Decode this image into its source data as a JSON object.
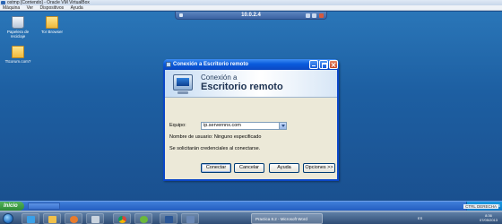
{
  "host_window": {
    "title": "ostmp [Corriendo] - Oracle VM VirtualBox",
    "menu": [
      "Máquina",
      "Ver",
      "Dispositivos",
      "Ayuda"
    ]
  },
  "guest": {
    "rdp_bar_title": "10.0.2.4",
    "desktop_icons": [
      {
        "label": "Papelera de reciclaje",
        "icon": "recycle-bin-icon"
      },
      {
        "label": "Tor Browser",
        "icon": "folder-icon"
      },
      {
        "label": "Ttcorum.com?",
        "icon": "folder-icon"
      }
    ],
    "taskbar": {
      "start_label": "Inicio",
      "task_label": "",
      "tray_time": "9:36"
    }
  },
  "dialog": {
    "title": "Conexión a Escritorio remoto",
    "banner_line1": "Conexión a",
    "banner_line2": "Escritorio remoto",
    "computer_label": "Equipo:",
    "computer_value": "ip.servernnx.com",
    "username_text": "Nombre de usuario:  Ninguno especificado",
    "credentials_text": "Se solicitarán credenciales al conectarse.",
    "buttons": {
      "connect": "Conectar",
      "cancel": "Cancelar",
      "help": "Ayuda",
      "options": "Opciones >>"
    }
  },
  "host_status": {
    "host_key": "CTRL DERECHA"
  },
  "host_taskbar": {
    "word_task": "Practica 8.2 - Microsoft Word",
    "language": "ES",
    "time": "8:36",
    "date": "07/05/2013"
  }
}
